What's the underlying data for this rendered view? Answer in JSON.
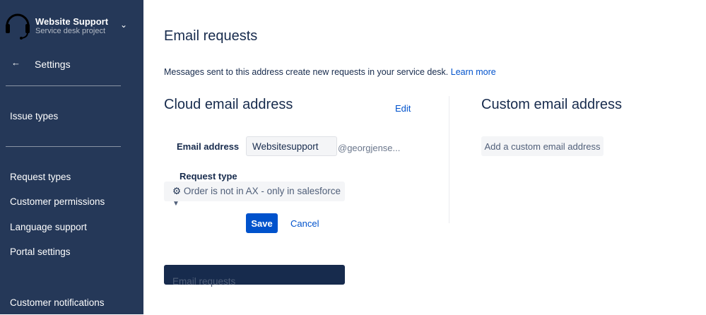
{
  "sidebar": {
    "project_name": "Website Support",
    "project_type": "Service desk project",
    "back_label": "Settings",
    "items": [
      "Issue types",
      "Request types",
      "Customer permissions",
      "Language support",
      "Portal settings",
      "Email requests",
      "Customer notifications"
    ]
  },
  "main": {
    "title": "Email requests",
    "description": "Messages sent to this address create new requests in your service desk.",
    "learn_more": "Learn more",
    "cloud": {
      "heading": "Cloud email address",
      "edit": "Edit",
      "email_label": "Email address",
      "email_value": "Websitesupport",
      "domain": "@georgjense...",
      "request_type_label": "Request type",
      "request_type_value": "Order is not in AX - only in salesforce",
      "save": "Save",
      "cancel": "Cancel"
    },
    "custom": {
      "heading": "Custom email address",
      "add_button": "Add a custom email address"
    }
  }
}
